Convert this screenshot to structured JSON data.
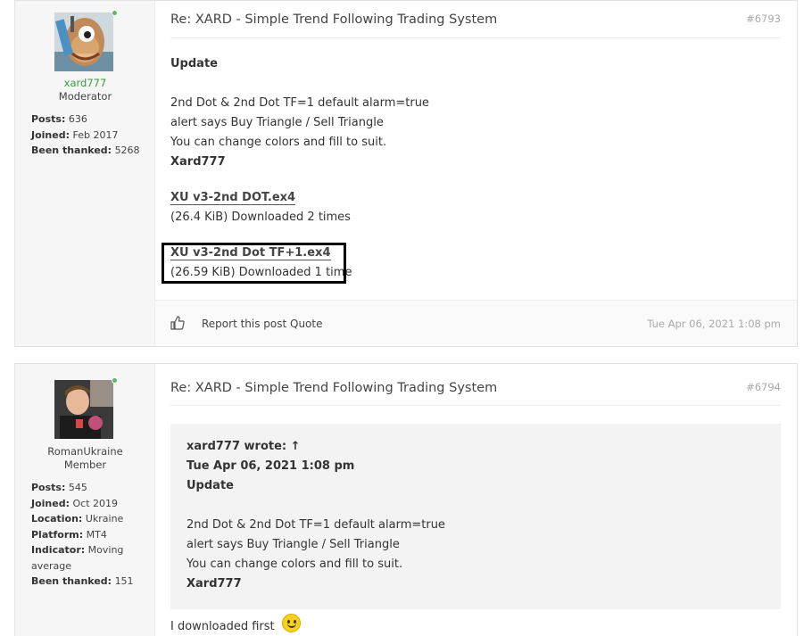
{
  "posts": [
    {
      "author": {
        "username": "xard777",
        "username_color": "#3a9a3a",
        "rank": "Moderator",
        "stats": [
          {
            "label": "Posts:",
            "value": "636"
          },
          {
            "label": "Joined:",
            "value": "Feb 2017"
          },
          {
            "label": "Been thanked:",
            "value": "5268"
          }
        ]
      },
      "title": "Re: XARD - Simple Trend Following Trading System",
      "number": "#6793",
      "content": {
        "heading": "Update",
        "lines": [
          "2nd Dot & 2nd Dot TF=1 default alarm=true",
          "alert says Buy Triangle / Sell Triangle",
          "You can change colors and fill to suit."
        ],
        "signature": "Xard777"
      },
      "attachments": [
        {
          "name": "XU v3-2nd DOT.ex4",
          "meta": "(26.4 KiB) Downloaded 2 times"
        },
        {
          "name": "XU v3-2nd Dot TF+1.ex4",
          "meta": "(26.59 KiB) Downloaded 1 time"
        }
      ],
      "footer": {
        "report_label": "Report this post",
        "quote_label": "Quote",
        "date": "Tue Apr 06, 2021 1:08 pm"
      }
    },
    {
      "author": {
        "username": "RomanUkraine",
        "rank": "Member",
        "stats": [
          {
            "label": "Posts:",
            "value": "545"
          },
          {
            "label": "Joined:",
            "value": "Oct 2019"
          },
          {
            "label": "Location:",
            "value": "Ukraine"
          },
          {
            "label": "Platform:",
            "value": "MT4"
          },
          {
            "label": "Indicator:",
            "value": "Moving average"
          },
          {
            "label": "Been thanked:",
            "value": "151"
          }
        ]
      },
      "title": "Re: XARD - Simple Trend Following Trading System",
      "number": "#6794",
      "quote": {
        "author_line": "xard777 wrote: ↑",
        "date": "Tue Apr 06, 2021 1:08 pm",
        "heading": "Update",
        "lines": [
          "2nd Dot & 2nd Dot TF=1 default alarm=true",
          "alert says Buy Triangle / Sell Triangle",
          "You can change colors and fill to suit."
        ],
        "signature": "Xard777"
      },
      "reply_text": "I downloaded first"
    }
  ]
}
